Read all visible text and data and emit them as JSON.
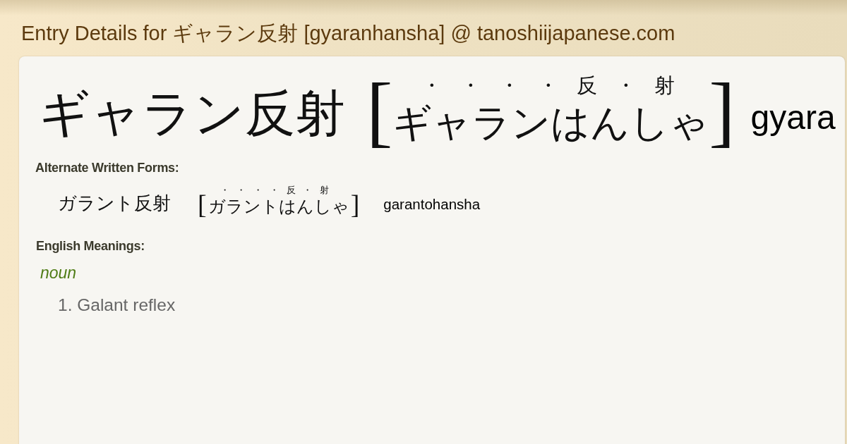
{
  "page_title": "Entry Details for ギャラン反射 [gyaranhansha] @ tanoshiijapanese.com",
  "entry": {
    "headword": "ギャラン反射",
    "open_bracket": "[",
    "reading": "ギャランはんしゃ",
    "reading_marks": [
      "・",
      "・",
      "・",
      "・",
      "反",
      "・",
      "射"
    ],
    "close_bracket": "]",
    "romaji": "gyara"
  },
  "alternate_forms": {
    "label": "Alternate Written Forms:",
    "items": [
      {
        "written": "ガラント反射",
        "open_bracket": "[",
        "reading": "ガラントはんしゃ",
        "reading_marks": [
          "・",
          "・",
          "・",
          "・",
          "反",
          "・",
          "射"
        ],
        "close_bracket": "]",
        "romaji": "garantohansha"
      }
    ]
  },
  "english_meanings": {
    "label": "English Meanings:",
    "groups": [
      {
        "part_of_speech": "noun",
        "senses": [
          "1. Galant reflex"
        ]
      }
    ]
  }
}
